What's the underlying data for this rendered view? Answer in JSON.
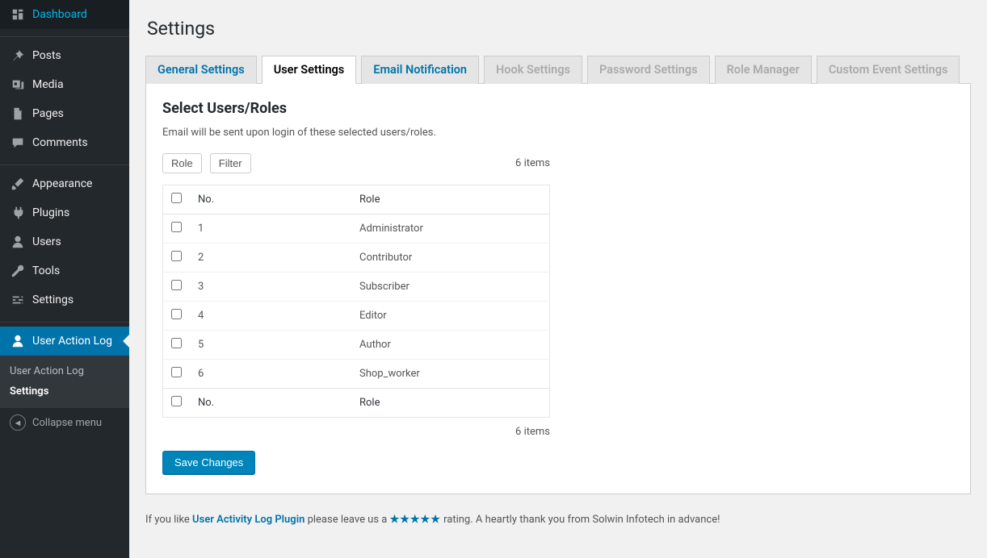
{
  "sidebar": {
    "items": [
      {
        "label": "Dashboard"
      },
      {
        "label": "Posts"
      },
      {
        "label": "Media"
      },
      {
        "label": "Pages"
      },
      {
        "label": "Comments"
      },
      {
        "label": "Appearance"
      },
      {
        "label": "Plugins"
      },
      {
        "label": "Users"
      },
      {
        "label": "Tools"
      },
      {
        "label": "Settings"
      },
      {
        "label": "User Action Log"
      }
    ],
    "submenu": [
      {
        "label": "User Action Log"
      },
      {
        "label": "Settings"
      }
    ],
    "collapse": "Collapse menu"
  },
  "page": {
    "title": "Settings"
  },
  "tabs": [
    {
      "label": "General Settings"
    },
    {
      "label": "User Settings"
    },
    {
      "label": "Email Notification"
    },
    {
      "label": "Hook Settings"
    },
    {
      "label": "Password Settings"
    },
    {
      "label": "Role Manager"
    },
    {
      "label": "Custom Event Settings"
    }
  ],
  "section": {
    "title": "Select Users/Roles",
    "desc": "Email will be sent upon login of these selected users/roles.",
    "role_btn": "Role",
    "filter_btn": "Filter",
    "items_count": "6 items",
    "table": {
      "head_no": "No.",
      "head_role": "Role",
      "rows": [
        {
          "no": "1",
          "role": "Administrator"
        },
        {
          "no": "2",
          "role": "Contributor"
        },
        {
          "no": "3",
          "role": "Subscriber"
        },
        {
          "no": "4",
          "role": "Editor"
        },
        {
          "no": "5",
          "role": "Author"
        },
        {
          "no": "6",
          "role": "Shop_worker"
        }
      ]
    },
    "save": "Save Changes"
  },
  "footer": {
    "prefix": "If you like ",
    "plugin": "User Activity Log Plugin",
    "mid": " please leave us a ",
    "stars": "★★★★★",
    "suffix": " rating. A heartly thank you from Solwin Infotech in advance!"
  }
}
